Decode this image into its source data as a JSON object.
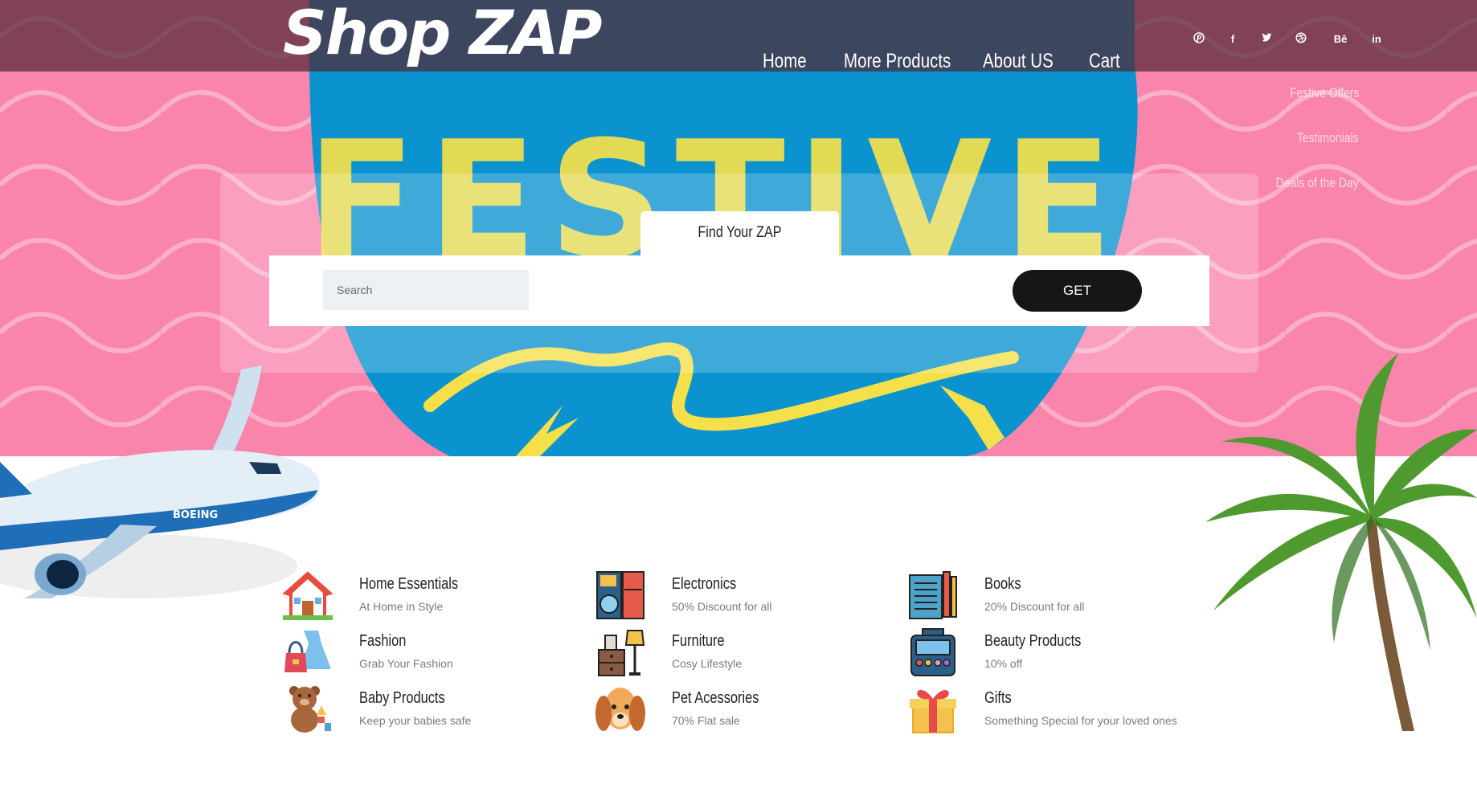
{
  "header": {
    "logo": "Shop ZAP",
    "nav": [
      "Home",
      "More Products",
      "About US",
      "Cart"
    ],
    "social_icons": [
      "pinterest-icon",
      "facebook-icon",
      "twitter-icon",
      "dribbble-icon",
      "behance-icon",
      "linkedin-icon"
    ],
    "social_labels": {
      "behance": "Bē",
      "linkedin": "in",
      "facebook": "f"
    }
  },
  "side_links": [
    "Festive Offers",
    "Testimonials",
    "Deals of the Day"
  ],
  "hero": {
    "banner_text": "FESTIVE"
  },
  "search": {
    "tab_label": "Find Your ZAP",
    "placeholder": "Search",
    "button_label": "GET"
  },
  "categories": [
    {
      "title": "Home Essentials",
      "subtitle": "At Home in Style",
      "icon": "house-icon"
    },
    {
      "title": "Electronics",
      "subtitle": "50% Discount for all",
      "icon": "appliances-icon"
    },
    {
      "title": "Books",
      "subtitle": "20% Discount for all",
      "icon": "books-icon"
    },
    {
      "title": "Fashion",
      "subtitle": "Grab Your Fashion",
      "icon": "dress-icon"
    },
    {
      "title": "Furniture",
      "subtitle": "Cosy Lifestyle",
      "icon": "lamp-icon"
    },
    {
      "title": "Beauty Products",
      "subtitle": "10% off",
      "icon": "makeup-icon"
    },
    {
      "title": "Baby Products",
      "subtitle": "Keep your babies safe",
      "icon": "teddy-bear-icon"
    },
    {
      "title": "Pet Acessories",
      "subtitle": "70% Flat sale",
      "icon": "dog-icon"
    },
    {
      "title": "Gifts",
      "subtitle": "Something Special for your loved ones",
      "icon": "gift-icon"
    }
  ],
  "colors": {
    "hero_pink": "#f985ad",
    "circle_blue": "#0a93cf",
    "festive_yellow": "#f5e04a",
    "button_dark": "#161616"
  }
}
